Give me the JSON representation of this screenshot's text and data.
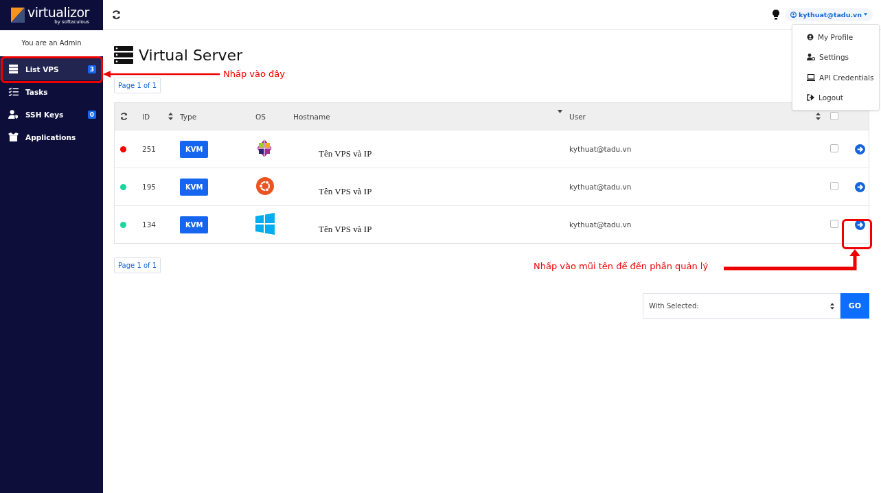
{
  "brand": {
    "name": "virtualizor",
    "byline": "by softaculous"
  },
  "sidebar": {
    "role_text": "You are an Admin",
    "items": [
      {
        "label": "List VPS",
        "badge": "3",
        "selected": true
      },
      {
        "label": "Tasks",
        "selected": false
      },
      {
        "label": "SSH Keys",
        "badge": "0",
        "selected": false
      },
      {
        "label": "Applications",
        "selected": false
      }
    ]
  },
  "topbar": {
    "user": "kythuat@tadu.vn"
  },
  "user_menu": [
    {
      "label": "My Profile"
    },
    {
      "label": "Settings"
    },
    {
      "label": "API Credentials"
    },
    {
      "label": "Logout"
    }
  ],
  "page": {
    "title": "Virtual Server",
    "pagination_top": "Page 1 of 1",
    "pagination_bottom": "Page 1 of 1"
  },
  "table": {
    "columns": [
      "ID",
      "Type",
      "OS",
      "Hostname",
      "User"
    ],
    "select_all_checked": false,
    "rows": [
      {
        "color": "#ff0000",
        "id": "251",
        "type": "KVM",
        "kind": "centos",
        "hostname": "Tên VPS và IP",
        "user": "kythuat@tadu.vn",
        "checked": false
      },
      {
        "color": "#1dd3a0",
        "id": "195",
        "type": "KVM",
        "kind": "ubuntu",
        "hostname": "Tên VPS và IP",
        "user": "kythuat@tadu.vn",
        "checked": false
      },
      {
        "color": "#1dd3a0",
        "id": "134",
        "type": "KVM",
        "kind": "windows",
        "hostname": "Tên VPS và IP",
        "user": "kythuat@tadu.vn",
        "checked": false
      }
    ]
  },
  "bulk_action": {
    "select": "With Selected:",
    "button": "GO"
  },
  "annotations": [
    {
      "text": "Nhấp vào đây"
    },
    {
      "text": "Nhấp vào mũi tên để đến phần quản lý"
    }
  ]
}
